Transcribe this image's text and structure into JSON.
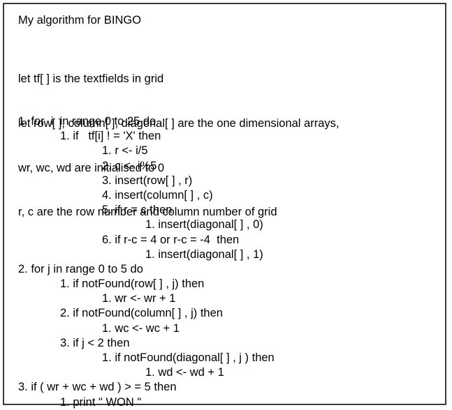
{
  "title": "My algorithm for BINGO",
  "preamble": [
    "let tf[ ] is the textfields in grid",
    "let row[ ], column[ ], diagonal[ ] are the one dimensional arrays,",
    "wr, wc, wd are initialised to 0",
    "r, c are the row number and column number of grid"
  ],
  "steps": [
    {
      "level": 0,
      "text": "1. for  i  in range 0 to 25 do"
    },
    {
      "level": 1,
      "text": "1. if   tf[i] ! = 'X' then"
    },
    {
      "level": 2,
      "text": "1. r <- i/5"
    },
    {
      "level": 2,
      "text": "2. c <- i%5"
    },
    {
      "level": 2,
      "text": "3. insert(row[ ] , r)"
    },
    {
      "level": 2,
      "text": "4. insert(column[ ] , c)"
    },
    {
      "level": 2,
      "text": "5. if r = c then"
    },
    {
      "level": 3,
      "text": "1. insert(diagonal[ ] , 0)"
    },
    {
      "level": 2,
      "text": "6. if r-c = 4 or r-c = -4  then"
    },
    {
      "level": 3,
      "text": "1. insert(diagonal[ ] , 1)"
    },
    {
      "level": 0,
      "text": "2. for j in range 0 to 5 do"
    },
    {
      "level": 1,
      "text": "1. if notFound(row[ ] , j) then"
    },
    {
      "level": 2,
      "text": "1. wr <- wr + 1"
    },
    {
      "level": 1,
      "text": "2. if notFound(column[ ] , j) then"
    },
    {
      "level": 2,
      "text": "1. wc <- wc + 1"
    },
    {
      "level": 1,
      "text": "3. if j < 2 then"
    },
    {
      "level": 2,
      "text": "1. if notFound(diagonal[ ] , j ) then"
    },
    {
      "level": 3,
      "text": "1. wd <- wd + 1"
    },
    {
      "level": 0,
      "text": "3. if ( wr + wc + wd ) > = 5 then"
    },
    {
      "level": 1,
      "text": "1. print \" WON \""
    }
  ]
}
